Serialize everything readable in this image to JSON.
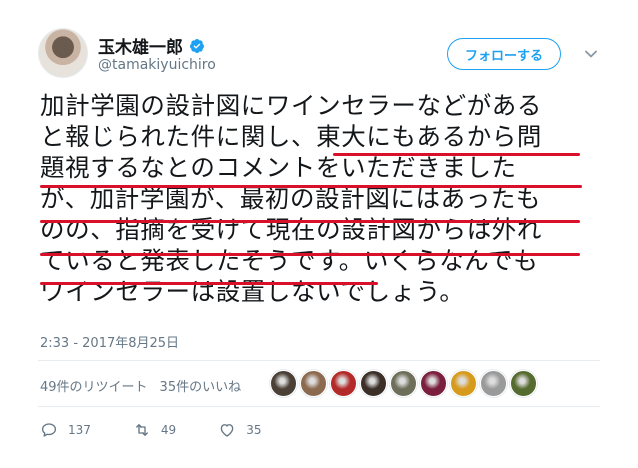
{
  "author": {
    "display_name": "玉木雄一郎",
    "handle": "@tamakiyuichiro",
    "verified": true
  },
  "follow_button_label": "フォローする",
  "tweet": {
    "lines": [
      "加計学園の設計図にワインセラーなどがある",
      "と報じられた件に関し、東大にもあるから問",
      "題視するなとのコメントをいただきました",
      "が、加計学園が、最初の設計図にはあったも",
      "のの、指摘を受けて現在の設計図からは外れ",
      "ていると発表したそうです。いくらなんでも",
      "ワインセラーは設置しないでしょう。"
    ],
    "timestamp": "2:33 - 2017年8月25日"
  },
  "stats": {
    "retweets": "49件のリツイート",
    "likes": "35件のいいね"
  },
  "likers": [
    {
      "icon": "liker-avatar",
      "color": "#4a4036"
    },
    {
      "icon": "liker-avatar",
      "color": "#8c6a4f"
    },
    {
      "icon": "liker-avatar",
      "color": "#b32a2a"
    },
    {
      "icon": "liker-avatar",
      "color": "#3b2f28"
    },
    {
      "icon": "liker-avatar",
      "color": "#6d6f5a"
    },
    {
      "icon": "liker-avatar",
      "color": "#7a1f3d"
    },
    {
      "icon": "liker-avatar",
      "color": "#d69a1c"
    },
    {
      "icon": "liker-avatar",
      "color": "#9a9a9a"
    },
    {
      "icon": "liker-avatar",
      "color": "#556b2f"
    }
  ],
  "actions": {
    "reply_count": "137",
    "retweet_count": "49",
    "like_count": "35"
  },
  "colors": {
    "accent": "#1da1f2",
    "underline": "#d8102a",
    "muted": "#657786"
  }
}
